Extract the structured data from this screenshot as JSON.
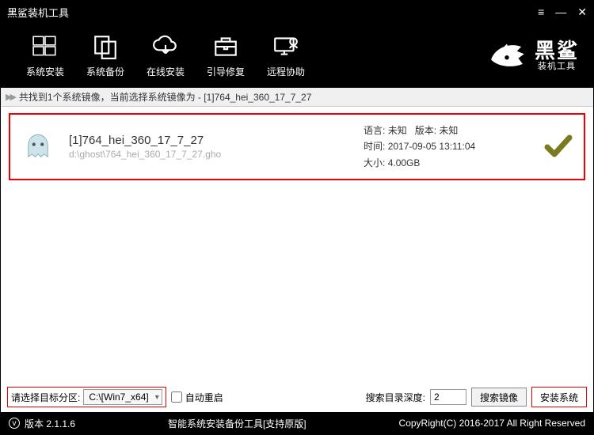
{
  "window": {
    "title": "黑鲨装机工具"
  },
  "toolbar": {
    "install": "系统安装",
    "backup": "系统备份",
    "online": "在线安装",
    "boot_repair": "引导修复",
    "remote": "远程协助"
  },
  "logo": {
    "big": "黑鲨",
    "small": "装机工具"
  },
  "info_strip": "共找到1个系统镜像，当前选择系统镜像为 - [1]764_hei_360_17_7_27",
  "image": {
    "title": "[1]764_hei_360_17_7_27",
    "path": "d:\\ghost\\764_hei_360_17_7_27.gho",
    "lang_label": "语言:",
    "lang_value": "未知",
    "ver_label": "版本:",
    "ver_value": "未知",
    "time_label": "时间:",
    "time_value": "2017-09-05 13:11:04",
    "size_label": "大小:",
    "size_value": "4.00GB"
  },
  "bottom": {
    "partition_label": "请选择目标分区:",
    "partition_value": "C:\\[Win7_x64]",
    "auto_restart": "自动重启",
    "depth_label": "搜索目录深度:",
    "depth_value": "2",
    "search_btn": "搜索镜像",
    "install_btn": "安装系统"
  },
  "status": {
    "version": "版本 2.1.1.6",
    "center": "智能系统安装备份工具[支持原版]",
    "copyright": "CopyRight(C) 2016-2017 All Right Reserved"
  }
}
